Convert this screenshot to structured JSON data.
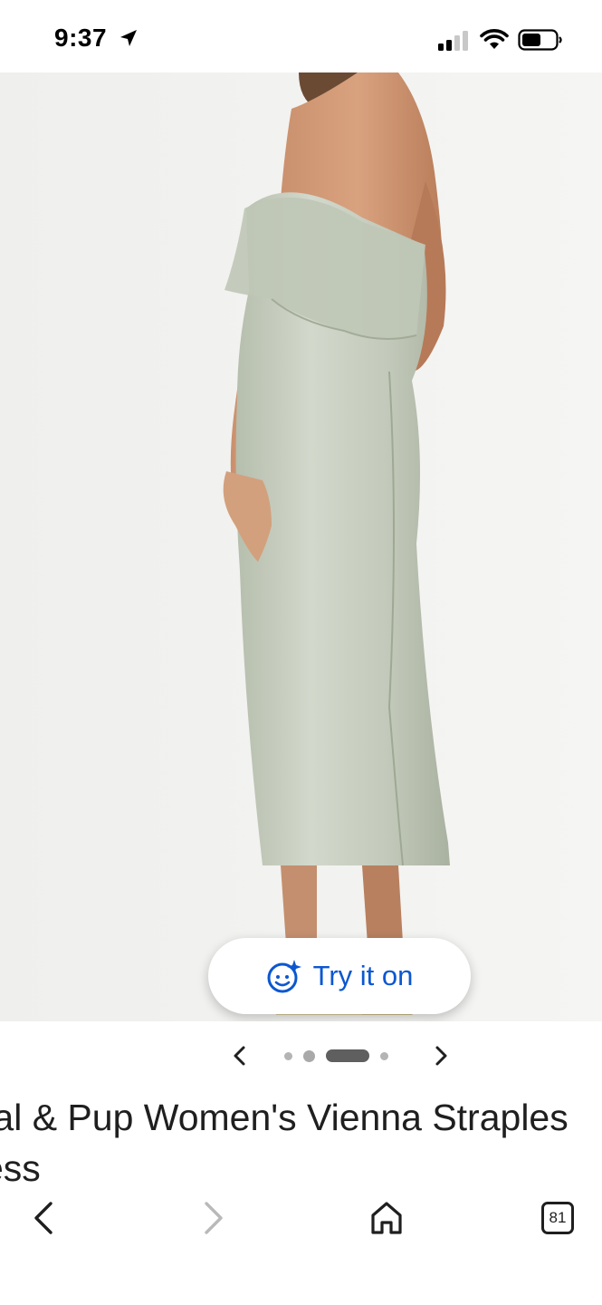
{
  "status_bar": {
    "time": "9:37",
    "icons": [
      "location-arrow-icon",
      "cellular-signal-icon",
      "wifi-icon",
      "battery-icon"
    ]
  },
  "product": {
    "image_icon": "dress-photo",
    "try_on": {
      "label": "Try it on",
      "icon": "sparkle-face-icon",
      "color": "#0b57d0"
    },
    "carousel": {
      "total_images": 4,
      "active_index": 2
    },
    "title_lines": [
      "tal & Pup Women's Vienna Straples",
      "ess"
    ]
  },
  "toolbar": {
    "tabs_count": "81",
    "icons": [
      "back-arrow-icon",
      "forward-arrow-icon",
      "home-icon",
      "tabs-icon"
    ]
  },
  "colors": {
    "dress": "#c4cbbd",
    "background": "#f2f2f0",
    "accent": "#0b57d0"
  }
}
